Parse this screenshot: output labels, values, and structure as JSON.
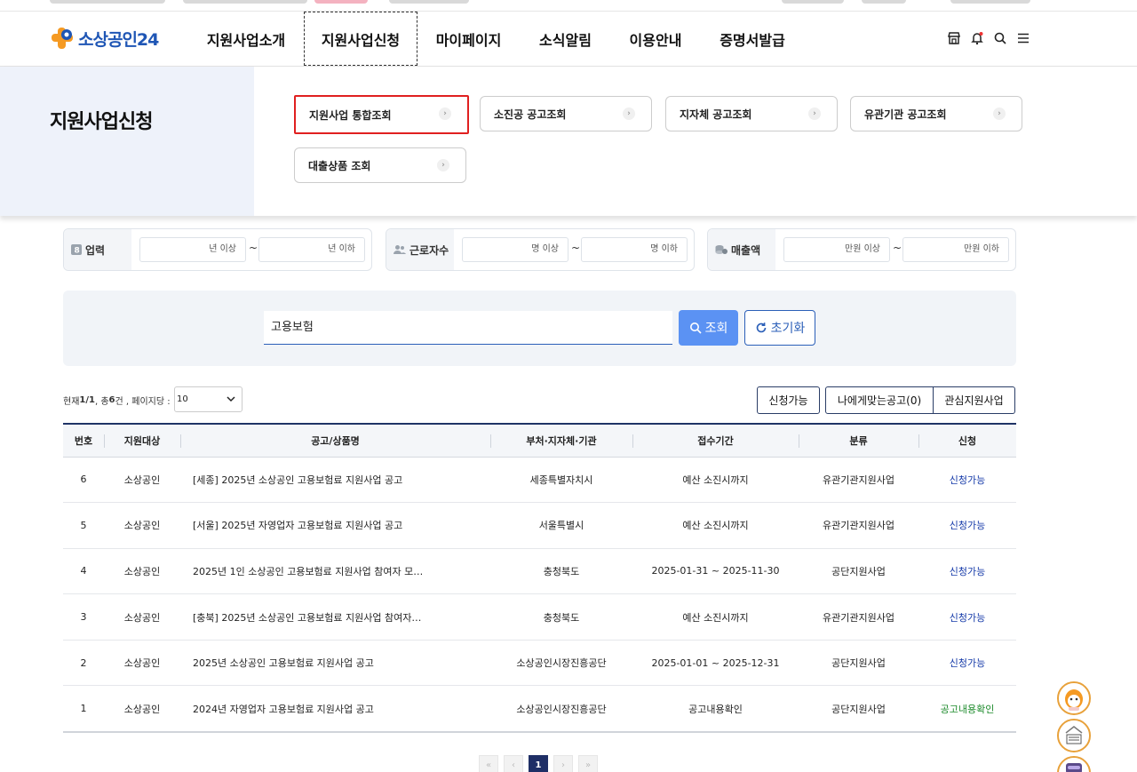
{
  "site": {
    "logo_text": "소상공인24"
  },
  "nav": [
    {
      "label": "지원사업소개"
    },
    {
      "label": "지원사업신청"
    },
    {
      "label": "마이페이지"
    },
    {
      "label": "소식알림"
    },
    {
      "label": "이용안내"
    },
    {
      "label": "증명서발급"
    }
  ],
  "band": {
    "title": "지원사업신청",
    "buttons": [
      {
        "label": "지원사업 통합조회"
      },
      {
        "label": "소진공 공고조회"
      },
      {
        "label": "지자체 공고조회"
      },
      {
        "label": "유관기관 공고조회"
      },
      {
        "label": "대출상품 조회"
      }
    ]
  },
  "filters": {
    "business_years": {
      "label": "업력",
      "min_placeholder": "년 이상",
      "max_placeholder": "년 이하"
    },
    "employees": {
      "label": "근로자수",
      "min_placeholder": "명 이상",
      "max_placeholder": "명 이하"
    },
    "revenue": {
      "label": "매출액",
      "min_placeholder": "만원 이상",
      "max_placeholder": "만원 이하"
    },
    "tilde": "~"
  },
  "search": {
    "value": "고용보험",
    "search_label": "조회",
    "reset_label": "초기화"
  },
  "summary": {
    "prefix": "현재 ",
    "page": "1/1",
    "mid": " , 총 ",
    "total": "6",
    "suffix": "건 , 페이지당 :",
    "page_size": "10"
  },
  "tabs": [
    {
      "label": "신청가능"
    },
    {
      "label": "나에게맞는공고(0)"
    },
    {
      "label": "관심지원사업"
    }
  ],
  "table": {
    "headers": [
      "번호",
      "지원대상",
      "공고/상품명",
      "부처·지자체·기관",
      "접수기간",
      "분류",
      "신청"
    ],
    "rows": [
      {
        "no": "6",
        "target": "소상공인",
        "title": "[세종] 2025년 소상공인 고용보험료 지원사업 공고",
        "agency": "세종특별자치시",
        "period": "예산 소진시까지",
        "category": "유관기관지원사업",
        "status": "신청가능"
      },
      {
        "no": "5",
        "target": "소상공인",
        "title": "[서울] 2025년 자영업자 고용보험료 지원사업 공고",
        "agency": "서울특별시",
        "period": "예산 소진시까지",
        "category": "유관기관지원사업",
        "status": "신청가능"
      },
      {
        "no": "4",
        "target": "소상공인",
        "title": "2025년 1인 소상공인 고용보험료 지원사업 참여자 모…",
        "agency": "충청북도",
        "period": "2025-01-31 ~ 2025-11-30",
        "category": "공단지원사업",
        "status": "신청가능"
      },
      {
        "no": "3",
        "target": "소상공인",
        "title": "[충북] 2025년 소상공인 고용보험료 지원사업 참여자…",
        "agency": "충청북도",
        "period": "예산 소진시까지",
        "category": "유관기관지원사업",
        "status": "신청가능"
      },
      {
        "no": "2",
        "target": "소상공인",
        "title": "2025년 소상공인 고용보험료 지원사업 공고",
        "agency": "소상공인시장진흥공단",
        "period": "2025-01-01 ~ 2025-12-31",
        "category": "공단지원사업",
        "status": "신청가능"
      },
      {
        "no": "1",
        "target": "소상공인",
        "title": "2024년 자영업자 고용보험료 지원사업 공고",
        "agency": "소상공인시장진흥공단",
        "period": "공고내용확인",
        "category": "공단지원사업",
        "status": "공고내용확인"
      }
    ]
  },
  "pagination": {
    "current": "1"
  },
  "colors": {
    "brand": "#1f56b5",
    "accent_orange": "#f59a23",
    "status_blue": "#1439a8",
    "status_green": "#1b8a2a",
    "search_btn": "#5b92f3"
  }
}
